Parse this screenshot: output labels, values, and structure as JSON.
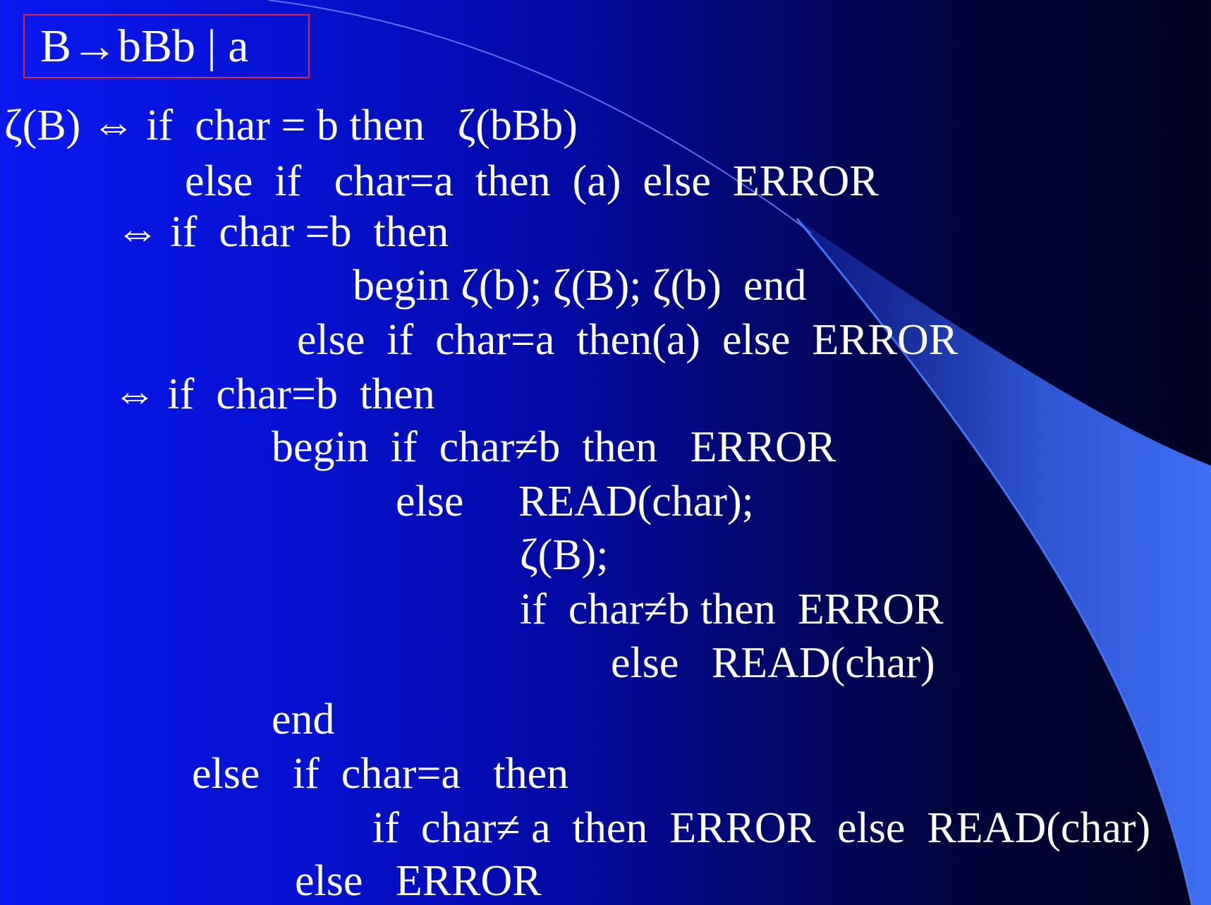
{
  "slide": {
    "title": "B→bBb | a",
    "lines": [
      "ζ(B) ⇔ if  char = b then   ζ(bBb)",
      "else  if   char=a  then  (a)  else  ERROR",
      "⇔ if  char =b  then",
      "begin ζ(b); ζ(B); ζ(b)  end",
      "else  if  char=a  then(a)  else  ERROR",
      "⇔ if  char=b  then",
      "begin  if  char≠b  then   ERROR",
      "else     READ(char);",
      "ζ(B);",
      "if  char≠b then  ERROR",
      "else   READ(char)",
      "end",
      "else   if  char=a   then",
      "if  char≠ a  then  ERROR  else  READ(char)",
      "else   ERROR"
    ]
  },
  "colors": {
    "background_left": "#0a18f2",
    "background_right": "#000020",
    "accent_curve": "#3a6cf0",
    "title_border": "#e0283c",
    "text": "#ffffff"
  }
}
